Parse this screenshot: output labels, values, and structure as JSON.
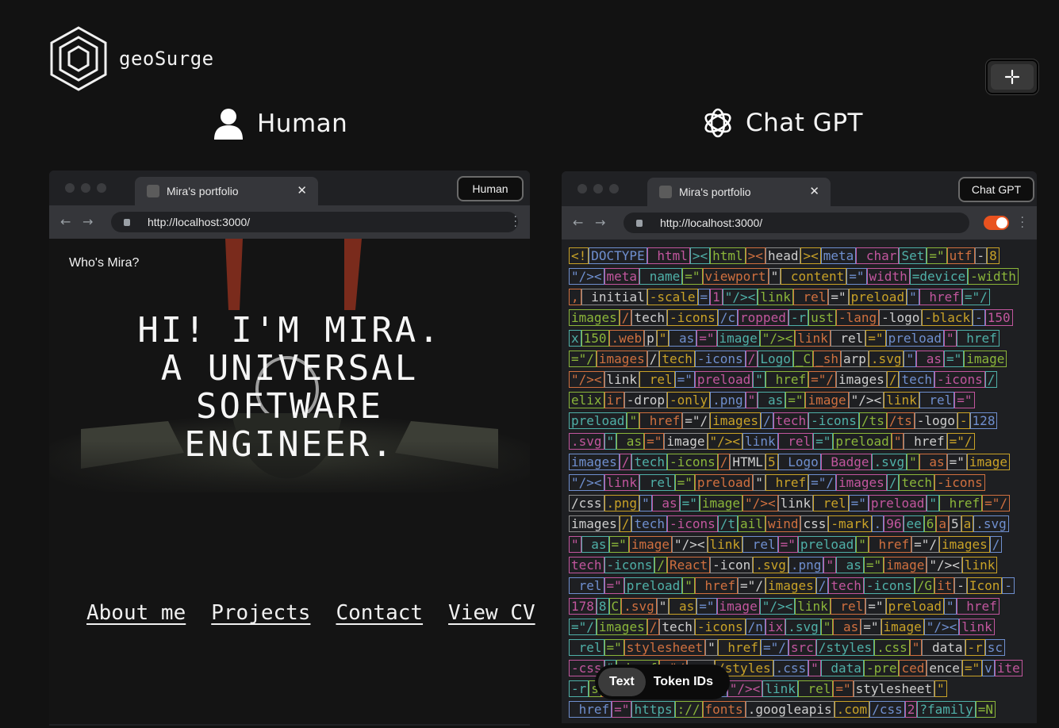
{
  "brand": {
    "name": "geoSurge"
  },
  "columns": {
    "left_title": "Human",
    "right_title": "Chat GPT"
  },
  "fullscreen_button": {
    "icon": "collapse-arrows-icon"
  },
  "left_browser": {
    "tab_title": "Mira's portfolio",
    "badge": "Human",
    "url": "http://localhost:3000/",
    "page": {
      "nav_title": "Who's Mira?",
      "hero_lines": [
        "HI! I'M MIRA.",
        "A UNIVERSAL",
        "SOFTWARE",
        "ENGINEER."
      ],
      "links": [
        "About me",
        "Projects",
        "Contact",
        "View CV"
      ]
    }
  },
  "right_browser": {
    "tab_title": "Mira's portfolio",
    "badge": "Chat GPT",
    "url": "http://localhost:3000/",
    "token_lines": [
      [
        "<!",
        "DOCTYPE",
        " html",
        "><",
        "html",
        "><",
        "head",
        "><",
        "meta",
        " char",
        "Set",
        "=\"",
        "utf",
        "-",
        "8"
      ],
      [
        "\"/><",
        "meta",
        " name",
        "=\"",
        "viewport",
        "\"",
        " content",
        "=\"",
        "width",
        "=device",
        "-width"
      ],
      [
        ",",
        " initial",
        "-scale",
        "=",
        "1",
        "\"/><",
        "link",
        " rel",
        "=\"",
        "preload",
        "\"",
        " href",
        "=\"/"
      ],
      [
        "images",
        "/",
        "tech",
        "-icons",
        "/c",
        "ropped",
        "-r",
        "ust",
        "-lang",
        "-logo",
        "-black",
        "-",
        "150"
      ],
      [
        "x",
        "150",
        ".web",
        "p",
        "\"",
        " as",
        "=\"",
        "image",
        "\"/><",
        "link",
        " rel",
        "=\"",
        "preload",
        "\"",
        " href"
      ],
      [
        "=\"/",
        "images",
        "/",
        "tech",
        "-icons",
        "/",
        "Logo",
        "_C",
        "_sh",
        "arp",
        ".svg",
        "\"",
        " as",
        "=\"",
        "image"
      ],
      [
        "\"/><",
        "link",
        " rel",
        "=\"",
        "preload",
        "\"",
        " href",
        "=\"/",
        "images",
        "/",
        "tech",
        "-icons",
        "/"
      ],
      [
        "elix",
        "ir",
        "-drop",
        "-only",
        ".png",
        "\"",
        " as",
        "=\"",
        "image",
        "\"/><",
        "link",
        " rel",
        "=\""
      ],
      [
        "preload",
        "\"",
        " href",
        "=\"/",
        "images",
        "/",
        "tech",
        "-icons",
        "/ts",
        "/ts",
        "-logo",
        "-",
        "128"
      ],
      [
        ".svg",
        "\"",
        " as",
        "=\"",
        "image",
        "\"/><",
        "link",
        " rel",
        "=\"",
        "preload",
        "\"",
        " href",
        "=\"/"
      ],
      [
        "images",
        "/",
        "tech",
        "-icons",
        "/",
        "HTML",
        "5",
        " Logo",
        " Badge",
        ".svg",
        "\"",
        " as",
        "=\"",
        "image"
      ],
      [
        "\"/><",
        "link",
        " rel",
        "=\"",
        "preload",
        "\"",
        " href",
        "=\"/",
        "images",
        "/",
        "tech",
        "-icons"
      ],
      [
        "/css",
        ".png",
        "\"",
        " as",
        "=\"",
        "image",
        "\"/><",
        "link",
        " rel",
        "=\"",
        "preload",
        "\"",
        " href",
        "=\"/"
      ],
      [
        "images",
        "/",
        "tech",
        "-icons",
        "/t",
        "ail",
        "wind",
        "css",
        "-mark",
        ".",
        "96",
        "ee",
        "6",
        "a",
        "5",
        "a",
        ".svg"
      ],
      [
        "\"",
        " as",
        "=\"",
        "image",
        "\"/><",
        "link",
        " rel",
        "=\"",
        "preload",
        "\"",
        " href",
        "=\"/",
        "images",
        "/"
      ],
      [
        "tech",
        "-icons",
        "/",
        "React",
        "-icon",
        ".svg",
        ".png",
        "\"",
        " as",
        "=\"",
        "image",
        "\"/><",
        "link"
      ],
      [
        " rel",
        "=\"",
        "preload",
        "\"",
        " href",
        "=\"/",
        "images",
        "/",
        "tech",
        "-icons",
        "/G",
        "it",
        "-",
        "Icon",
        "-"
      ],
      [
        "178",
        "8",
        "C",
        ".svg",
        "\"",
        " as",
        "=\"",
        "image",
        "\"/><",
        "link",
        " rel",
        "=\"",
        "preload",
        "\"",
        " href"
      ],
      [
        "=\"/",
        "images",
        "/",
        "tech",
        "-icons",
        "/n",
        "ix",
        ".svg",
        "\"",
        " as",
        "=\"",
        "image",
        "\"/><",
        "link"
      ],
      [
        " rel",
        "=\"",
        "stylesheet",
        "\"",
        " href",
        "=\"/",
        "src",
        "/styles",
        ".css",
        "\"",
        " data",
        "-r",
        "sc"
      ],
      [
        "-css",
        "\"",
        " href",
        "=\"/",
        "src",
        "/styles",
        ".css",
        "\"",
        " data",
        "-pre",
        "ced",
        "ence",
        "=\"",
        "v",
        "ite"
      ],
      [
        "-r",
        "s",
        "\"",
        " data",
        "-sou",
        "rces",
        "\"/><",
        "link",
        " rel",
        "=\"",
        "stylesheet",
        "\""
      ],
      [
        " href",
        "=\"",
        "https",
        "://",
        "fonts",
        ".googleapis",
        ".com",
        "/css",
        "2",
        "?family",
        "=N"
      ]
    ],
    "token_colors": [
      "#c9a227",
      "#6f8fcf",
      "#c2569e",
      "#4fb0a8",
      "#8bb63a",
      "#d0703f",
      "#8a8a8a"
    ]
  },
  "view_toggle": {
    "active": "Text",
    "inactive": "Token IDs"
  }
}
